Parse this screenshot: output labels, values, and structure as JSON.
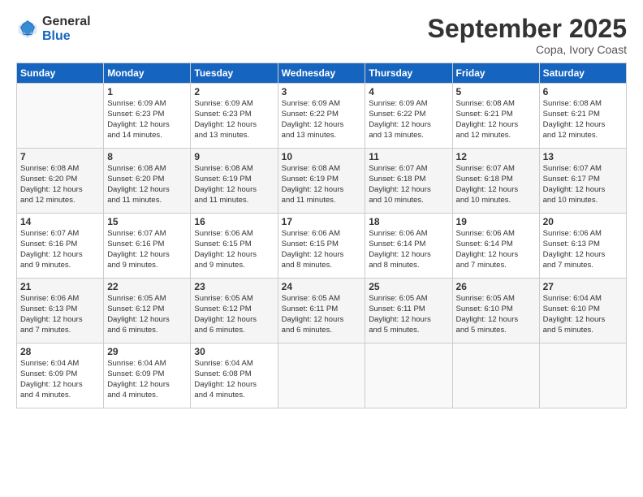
{
  "logo": {
    "general": "General",
    "blue": "Blue"
  },
  "header": {
    "month": "September 2025",
    "location": "Copa, Ivory Coast"
  },
  "days_of_week": [
    "Sunday",
    "Monday",
    "Tuesday",
    "Wednesday",
    "Thursday",
    "Friday",
    "Saturday"
  ],
  "weeks": [
    [
      {
        "day": "",
        "info": ""
      },
      {
        "day": "1",
        "info": "Sunrise: 6:09 AM\nSunset: 6:23 PM\nDaylight: 12 hours\nand 14 minutes."
      },
      {
        "day": "2",
        "info": "Sunrise: 6:09 AM\nSunset: 6:23 PM\nDaylight: 12 hours\nand 13 minutes."
      },
      {
        "day": "3",
        "info": "Sunrise: 6:09 AM\nSunset: 6:22 PM\nDaylight: 12 hours\nand 13 minutes."
      },
      {
        "day": "4",
        "info": "Sunrise: 6:09 AM\nSunset: 6:22 PM\nDaylight: 12 hours\nand 13 minutes."
      },
      {
        "day": "5",
        "info": "Sunrise: 6:08 AM\nSunset: 6:21 PM\nDaylight: 12 hours\nand 12 minutes."
      },
      {
        "day": "6",
        "info": "Sunrise: 6:08 AM\nSunset: 6:21 PM\nDaylight: 12 hours\nand 12 minutes."
      }
    ],
    [
      {
        "day": "7",
        "info": "Sunrise: 6:08 AM\nSunset: 6:20 PM\nDaylight: 12 hours\nand 12 minutes."
      },
      {
        "day": "8",
        "info": "Sunrise: 6:08 AM\nSunset: 6:20 PM\nDaylight: 12 hours\nand 11 minutes."
      },
      {
        "day": "9",
        "info": "Sunrise: 6:08 AM\nSunset: 6:19 PM\nDaylight: 12 hours\nand 11 minutes."
      },
      {
        "day": "10",
        "info": "Sunrise: 6:08 AM\nSunset: 6:19 PM\nDaylight: 12 hours\nand 11 minutes."
      },
      {
        "day": "11",
        "info": "Sunrise: 6:07 AM\nSunset: 6:18 PM\nDaylight: 12 hours\nand 10 minutes."
      },
      {
        "day": "12",
        "info": "Sunrise: 6:07 AM\nSunset: 6:18 PM\nDaylight: 12 hours\nand 10 minutes."
      },
      {
        "day": "13",
        "info": "Sunrise: 6:07 AM\nSunset: 6:17 PM\nDaylight: 12 hours\nand 10 minutes."
      }
    ],
    [
      {
        "day": "14",
        "info": "Sunrise: 6:07 AM\nSunset: 6:16 PM\nDaylight: 12 hours\nand 9 minutes."
      },
      {
        "day": "15",
        "info": "Sunrise: 6:07 AM\nSunset: 6:16 PM\nDaylight: 12 hours\nand 9 minutes."
      },
      {
        "day": "16",
        "info": "Sunrise: 6:06 AM\nSunset: 6:15 PM\nDaylight: 12 hours\nand 9 minutes."
      },
      {
        "day": "17",
        "info": "Sunrise: 6:06 AM\nSunset: 6:15 PM\nDaylight: 12 hours\nand 8 minutes."
      },
      {
        "day": "18",
        "info": "Sunrise: 6:06 AM\nSunset: 6:14 PM\nDaylight: 12 hours\nand 8 minutes."
      },
      {
        "day": "19",
        "info": "Sunrise: 6:06 AM\nSunset: 6:14 PM\nDaylight: 12 hours\nand 7 minutes."
      },
      {
        "day": "20",
        "info": "Sunrise: 6:06 AM\nSunset: 6:13 PM\nDaylight: 12 hours\nand 7 minutes."
      }
    ],
    [
      {
        "day": "21",
        "info": "Sunrise: 6:06 AM\nSunset: 6:13 PM\nDaylight: 12 hours\nand 7 minutes."
      },
      {
        "day": "22",
        "info": "Sunrise: 6:05 AM\nSunset: 6:12 PM\nDaylight: 12 hours\nand 6 minutes."
      },
      {
        "day": "23",
        "info": "Sunrise: 6:05 AM\nSunset: 6:12 PM\nDaylight: 12 hours\nand 6 minutes."
      },
      {
        "day": "24",
        "info": "Sunrise: 6:05 AM\nSunset: 6:11 PM\nDaylight: 12 hours\nand 6 minutes."
      },
      {
        "day": "25",
        "info": "Sunrise: 6:05 AM\nSunset: 6:11 PM\nDaylight: 12 hours\nand 5 minutes."
      },
      {
        "day": "26",
        "info": "Sunrise: 6:05 AM\nSunset: 6:10 PM\nDaylight: 12 hours\nand 5 minutes."
      },
      {
        "day": "27",
        "info": "Sunrise: 6:04 AM\nSunset: 6:10 PM\nDaylight: 12 hours\nand 5 minutes."
      }
    ],
    [
      {
        "day": "28",
        "info": "Sunrise: 6:04 AM\nSunset: 6:09 PM\nDaylight: 12 hours\nand 4 minutes."
      },
      {
        "day": "29",
        "info": "Sunrise: 6:04 AM\nSunset: 6:09 PM\nDaylight: 12 hours\nand 4 minutes."
      },
      {
        "day": "30",
        "info": "Sunrise: 6:04 AM\nSunset: 6:08 PM\nDaylight: 12 hours\nand 4 minutes."
      },
      {
        "day": "",
        "info": ""
      },
      {
        "day": "",
        "info": ""
      },
      {
        "day": "",
        "info": ""
      },
      {
        "day": "",
        "info": ""
      }
    ]
  ]
}
